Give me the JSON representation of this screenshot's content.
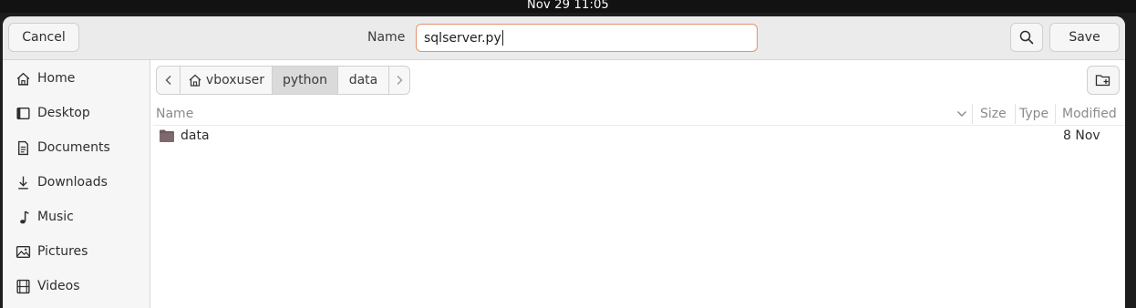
{
  "topbar": {
    "clock": "Nov 29  11:05"
  },
  "header": {
    "cancel_label": "Cancel",
    "name_label": "Name",
    "name_value": "sqlserver.py",
    "save_label": "Save"
  },
  "sidebar": {
    "items": [
      {
        "label": "Home",
        "icon": "home-icon"
      },
      {
        "label": "Desktop",
        "icon": "desktop-icon"
      },
      {
        "label": "Documents",
        "icon": "documents-icon"
      },
      {
        "label": "Downloads",
        "icon": "downloads-icon"
      },
      {
        "label": "Music",
        "icon": "music-icon"
      },
      {
        "label": "Pictures",
        "icon": "pictures-icon"
      },
      {
        "label": "Videos",
        "icon": "videos-icon"
      }
    ]
  },
  "pathbar": {
    "crumbs": [
      {
        "label": "vboxuser"
      },
      {
        "label": "python"
      },
      {
        "label": "data"
      }
    ],
    "active": "python"
  },
  "file_list": {
    "columns": {
      "name": "Name",
      "size": "Size",
      "type": "Type",
      "modified": "Modified"
    },
    "rows": [
      {
        "name": "data",
        "size": "",
        "type": "",
        "modified": "8 Nov",
        "icon": "folder-icon"
      }
    ]
  },
  "colors": {
    "input_focus_border": "#e3936f",
    "folder": "#6e5a5f",
    "active_crumb_bg": "#dadada"
  }
}
